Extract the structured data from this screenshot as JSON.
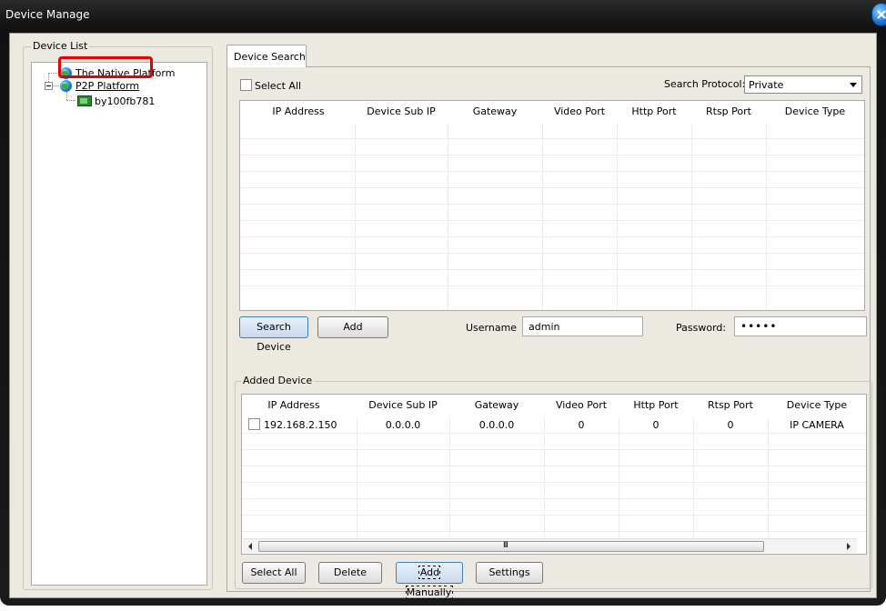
{
  "window": {
    "title": "Device Manage"
  },
  "device_list": {
    "label": "Device List",
    "nodes": [
      {
        "label": "The Native Platform",
        "icon": "globe-icon"
      },
      {
        "label": "P2P Platform",
        "icon": "globe-icon"
      },
      {
        "label": "by100fb781",
        "icon": "camera-icon",
        "highlighted": true
      }
    ]
  },
  "tabs": [
    {
      "label": "Device Search",
      "active": true
    }
  ],
  "search": {
    "select_all_label": "Select All",
    "protocol_label": "Search Protocol:",
    "protocol_value": "Private",
    "columns": [
      "IP Address",
      "Device Sub IP",
      "Gateway",
      "Video Port",
      "Http Port",
      "Rtsp Port",
      "Device Type"
    ],
    "rows": [],
    "search_button": "Search Device",
    "add_button": "Add",
    "username_label": "Username",
    "username_value": "admin",
    "password_label": "Password:",
    "password_value": "•••••"
  },
  "added": {
    "label": "Added Device",
    "columns": [
      "IP Address",
      "Device Sub IP",
      "Gateway",
      "Video Port",
      "Http Port",
      "Rtsp Port",
      "Device Type"
    ],
    "rows": [
      {
        "ip": "192.168.2.150",
        "sub_ip": "0.0.0.0",
        "gateway": "0.0.0.0",
        "video_port": "0",
        "http_port": "0",
        "rtsp_port": "0",
        "type": "IP CAMERA"
      }
    ],
    "scroll_grip": "III",
    "buttons": {
      "select_all": "Select All",
      "delete": "Delete",
      "add_manually": "Add Manually",
      "settings": "Settings"
    }
  },
  "colors": {
    "highlight_border": "#e60000",
    "window_frame": "#1a1a1a",
    "panel_bg": "#ece9e1"
  }
}
